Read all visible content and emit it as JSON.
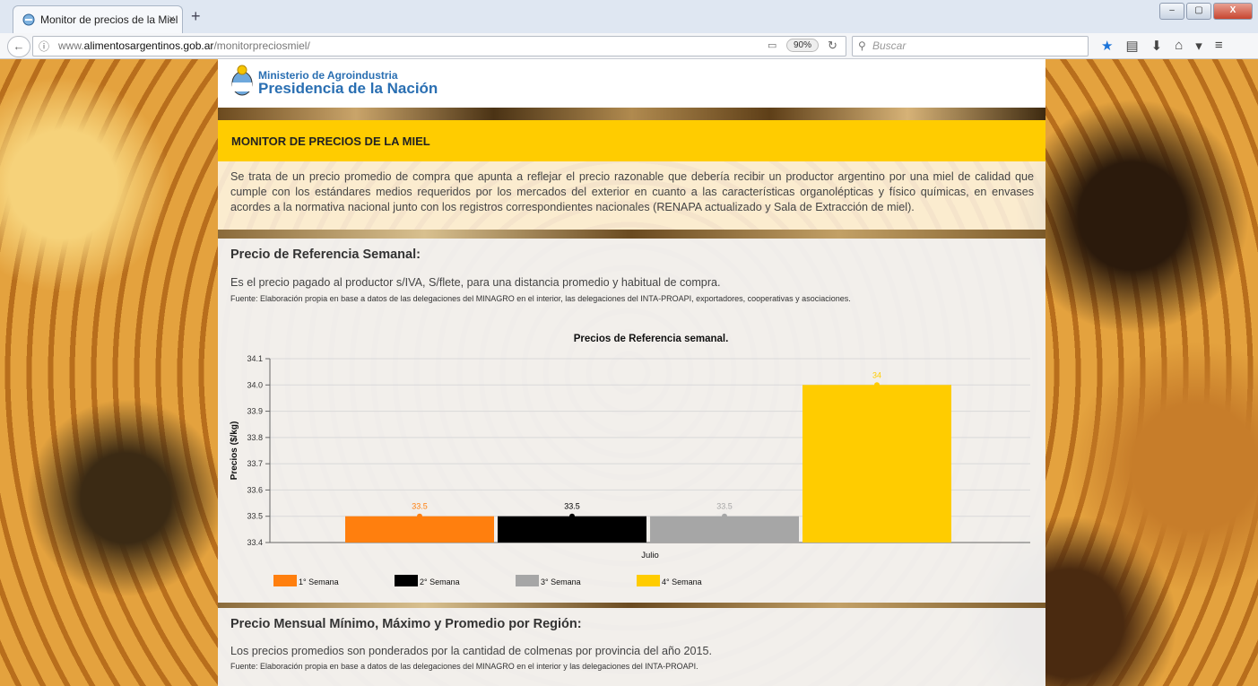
{
  "browser": {
    "tab_title": "Monitor de precios de la Miel",
    "tab_close": "×",
    "new_tab": "+",
    "url_prefix": "www.",
    "url_domain": "alimentosargentinos.gob.ar",
    "url_path": "/monitorpreciosmiel/",
    "zoom": "90%",
    "search_placeholder": "Buscar",
    "window_buttons": [
      "–",
      "▢",
      "X"
    ]
  },
  "header": {
    "ministerio": "Ministerio de Agroindustria",
    "presidencia": "Presidencia de la Nación"
  },
  "banner": {
    "title": "MONITOR DE PRECIOS DE LA MIEL",
    "intro": "Se trata de un precio promedio de compra que apunta a reflejar el precio razonable que debería recibir un productor argentino por una miel de calidad que cumple con los estándares medios requeridos por los mercados del exterior en cuanto a las características organolépticas y físico químicas, en envases acordes a la normativa nacional junto con los registros correspondientes nacionales (RENAPA actualizado y Sala de Extracción de miel)."
  },
  "weekly": {
    "title": "Precio de Referencia Semanal:",
    "description": "Es el precio pagado al productor s/IVA, S/flete, para una distancia promedio y habitual de compra.",
    "source": "Fuente: Elaboración propia en base a datos de las delegaciones del MINAGRO en el interior, las delegaciones del INTA-PROAPI, exportadores, cooperativas y asociaciones."
  },
  "regional": {
    "title": "Precio Mensual Mínimo, Máximo y Promedio por Región:",
    "description": "Los precios promedios son ponderados por la cantidad de colmenas por provincia del año 2015.",
    "source": "Fuente: Elaboración propia en base a datos de las delegaciones del MINAGRO en el interior y las delegaciones del INTA-PROAPI."
  },
  "chart_data": {
    "type": "bar",
    "title": "Precios de Referencia semanal.",
    "xlabel": "",
    "ylabel": "Precios ($/kg)",
    "categories": [
      "Julio"
    ],
    "ylim": [
      33.4,
      34.1
    ],
    "yticks": [
      "33.4",
      "33.5",
      "33.6",
      "33.7",
      "33.8",
      "33.9",
      "34.0",
      "34.1"
    ],
    "grid": true,
    "legend_position": "bottom-left",
    "series": [
      {
        "name": "1° Semana",
        "values": [
          33.5
        ],
        "label": "33.5",
        "color": "#ff7f0e"
      },
      {
        "name": "2° Semana",
        "values": [
          33.5
        ],
        "label": "33.5",
        "color": "#000000"
      },
      {
        "name": "3° Semana",
        "values": [
          33.5
        ],
        "label": "33.5",
        "color": "#a6a6a6"
      },
      {
        "name": "4° Semana",
        "values": [
          34.0
        ],
        "label": "34",
        "color": "#ffcc00"
      }
    ]
  }
}
